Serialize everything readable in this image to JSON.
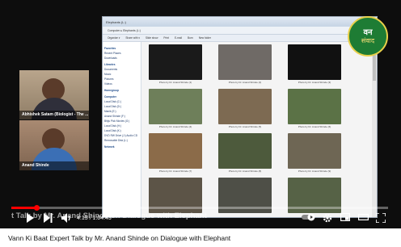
{
  "explorer": {
    "title_text": "Elephants (L:)",
    "address_text": "Computer ▸ Elephants (L:)",
    "toolbar_items": [
      "Organize ▾",
      "Share with ▾",
      "Slide show",
      "Print",
      "E-mail",
      "Burn",
      "New folder"
    ],
    "nav_items": [
      {
        "label": "Favorites",
        "group": true
      },
      {
        "label": "Recent Places",
        "group": false
      },
      {
        "label": "Downloads",
        "group": false
      },
      {
        "label": "Libraries",
        "group": true
      },
      {
        "label": "Documents",
        "group": false
      },
      {
        "label": "Music",
        "group": false
      },
      {
        "label": "Pictures",
        "group": false
      },
      {
        "label": "Videos",
        "group": false
      },
      {
        "label": "Homegroup",
        "group": true
      },
      {
        "label": "Computer",
        "group": true
      },
      {
        "label": "Local Disk (C:)",
        "group": false
      },
      {
        "label": "Local Disk (D:)",
        "group": false
      },
      {
        "label": "Manik (E:)",
        "group": false
      },
      {
        "label": "Anand Shinde (F:)",
        "group": false
      },
      {
        "label": "Bhiju Pick Movies (G:)",
        "group": false
      },
      {
        "label": "Local Disk (H:)",
        "group": false
      },
      {
        "label": "Local Disk (K:)",
        "group": false
      },
      {
        "label": "DVD RW Drive (J:) Audio CD",
        "group": false
      },
      {
        "label": "Removable Disk (L:)",
        "group": false
      },
      {
        "label": "Network",
        "group": true
      }
    ],
    "thumbnails": [
      {
        "caption": "Photo by Dr. Anand Shinde (1)",
        "color": "#1a1a1a"
      },
      {
        "caption": "Photo by Dr. Anand Shinde (2)",
        "color": "#6f6a66"
      },
      {
        "caption": "Photo by Dr. Anand Shinde (3)",
        "color": "#111111"
      },
      {
        "caption": "Photo by Dr. Anand Shinde (4)",
        "color": "#6e7f5a"
      },
      {
        "caption": "Photo by Dr. Anand Shinde (5)",
        "color": "#7d6a52"
      },
      {
        "caption": "Photo by Dr. Anand Shinde (6)",
        "color": "#5b7246"
      },
      {
        "caption": "Photo by Dr. Anand Shinde (7)",
        "color": "#8b6b49"
      },
      {
        "caption": "Photo by Dr. Anand Shinde (8)",
        "color": "#4d5a3c"
      },
      {
        "caption": "Photo by Dr. Anand Shinde (9)",
        "color": "#6e6654"
      },
      {
        "caption": "",
        "color": "#5c5447"
      },
      {
        "caption": "",
        "color": "#4e4f47"
      },
      {
        "caption": "",
        "color": "#566246"
      }
    ]
  },
  "participants": [
    {
      "name": "Abhishek Satam (Biologist - The ..."
    },
    {
      "name": "Anand Shinde"
    }
  ],
  "logo": {
    "line1": "वन",
    "line2": "संवाद"
  },
  "subtitle_text": "t Talk by Mr. Anand Shinde on Dialogue with Elephant",
  "player": {
    "current_time": "4:15",
    "duration": "1:04:43",
    "progress_fraction": 0.066,
    "left_icons": [
      "play-icon",
      "next-icon",
      "volume-icon"
    ],
    "right_icons": [
      "autoplay-toggle",
      "settings-icon",
      "miniplayer-icon",
      "theater-icon",
      "fullscreen-icon"
    ]
  },
  "video_title": "Vann Ki Baat Expert Talk by Mr. Anand Shinde on Dialogue with Elephant",
  "colors": {
    "progress": "#ff0000",
    "logo_green": "#1e7c34"
  }
}
